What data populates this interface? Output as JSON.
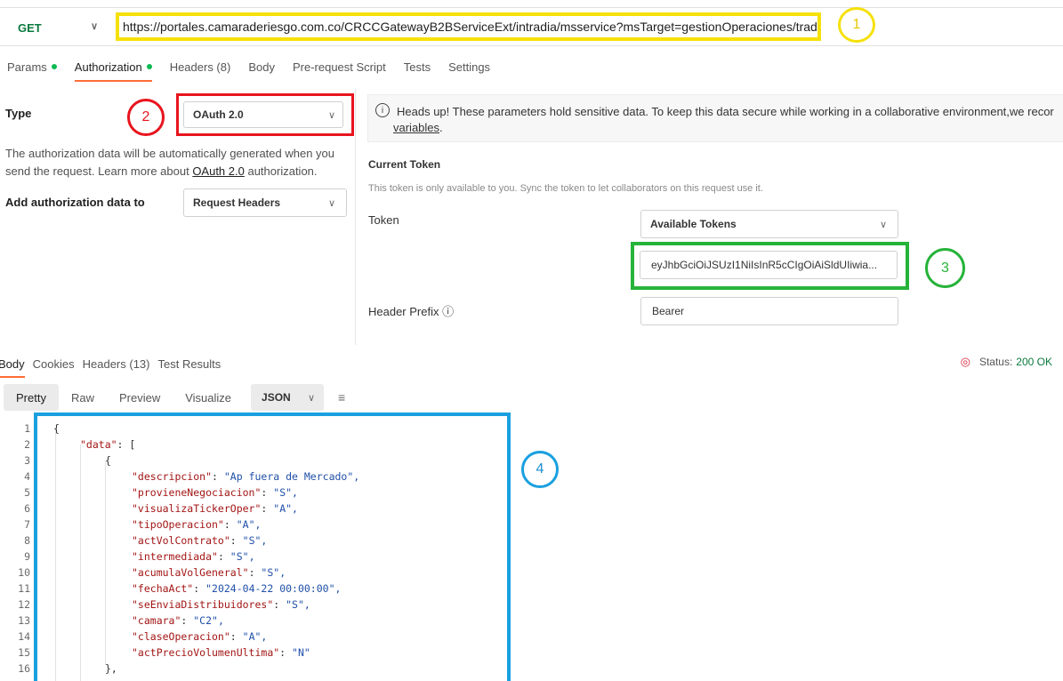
{
  "request": {
    "method": "GET",
    "url": "https://portales.camaraderiesgo.com.co/CRCCGatewayB2BServiceExt/intradia/msservice?msTarget=gestionOperaciones/tradetyp",
    "url_more": "·· -"
  },
  "callouts": [
    "1",
    "2",
    "3",
    "4"
  ],
  "request_tabs": [
    {
      "label": "Params",
      "dot": true
    },
    {
      "label": "Authorization",
      "dot": true
    },
    {
      "label": "Headers (8)",
      "dot": false
    },
    {
      "label": "Body",
      "dot": false
    },
    {
      "label": "Pre-request Script",
      "dot": false
    },
    {
      "label": "Tests",
      "dot": false
    },
    {
      "label": "Settings",
      "dot": false
    }
  ],
  "auth": {
    "type_label": "Type",
    "type_value": "OAuth 2.0",
    "desc_1": "The authorization data will be automatically generated when you send the request. Learn more about ",
    "desc_link": "OAuth 2.0",
    "desc_2": " authorization.",
    "add_label": "Add authorization data to",
    "add_value": "Request Headers"
  },
  "notice": {
    "text": "Heads up! These parameters hold sensitive data. To keep this data secure while working in a collaborative environment,we recor",
    "link": "variables",
    "link_suffix": "."
  },
  "token": {
    "section_title": "Current Token",
    "section_desc": "This token is only available to you. Sync the token to let collaborators on this request use it.",
    "label": "Token",
    "select_value": "Available Tokens",
    "value": "eyJhbGciOiJSUzI1NiIsInR5cCIgOiAiSldUIiwia...",
    "prefix_label": "Header Prefix ⓘ",
    "prefix_value": "Bearer"
  },
  "response": {
    "tabs": [
      "Body",
      "Cookies",
      "Headers (13)",
      "Test Results"
    ],
    "status_label": "Status:",
    "status_value": "200 OK",
    "views": [
      "Pretty",
      "Raw",
      "Preview",
      "Visualize"
    ],
    "format": "JSON"
  },
  "code": {
    "line_numbers": [
      "1",
      "2",
      "3",
      "4",
      "5",
      "6",
      "7",
      "8",
      "9",
      "10",
      "11",
      "12",
      "13",
      "14",
      "15",
      "16"
    ],
    "root_key": "\"data\"",
    "fields": [
      {
        "key": "\"descripcion\"",
        "value": "\"Ap fuera de Mercado\","
      },
      {
        "key": "\"provieneNegociacion\"",
        "value": "\"S\","
      },
      {
        "key": "\"visualizaTickerOper\"",
        "value": "\"A\","
      },
      {
        "key": "\"tipoOperacion\"",
        "value": "\"A\","
      },
      {
        "key": "\"actVolContrato\"",
        "value": "\"S\","
      },
      {
        "key": "\"intermediada\"",
        "value": "\"S\","
      },
      {
        "key": "\"acumulaVolGeneral\"",
        "value": "\"S\","
      },
      {
        "key": "\"fechaAct\"",
        "value": "\"2024-04-22 00:00:00\","
      },
      {
        "key": "\"seEnviaDistribuidores\"",
        "value": "\"S\","
      },
      {
        "key": "\"camara\"",
        "value": "\"C2\","
      },
      {
        "key": "\"claseOperacion\"",
        "value": "\"A\","
      },
      {
        "key": "\"actPrecioVolumenUltima\"",
        "value": "\"N\""
      }
    ]
  },
  "colors": {
    "accent": "#ff6c37",
    "get": "#0a7a3e",
    "callout_1": "#f5e10a",
    "callout_2": "#e8141e",
    "callout_3": "#26b33a",
    "callout_4": "#1aa0e0"
  }
}
